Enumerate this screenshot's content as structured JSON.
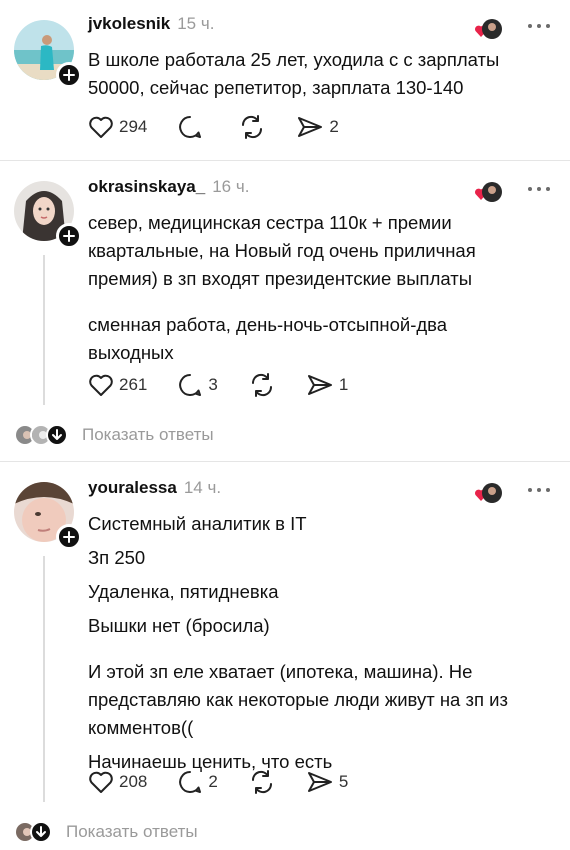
{
  "colors": {
    "text": "#111111",
    "muted": "#9a9a9a",
    "divider": "#e5e5e5",
    "heart_red": "#e8234a"
  },
  "posts": [
    {
      "username": "jvkolesnik",
      "time": "15 ч.",
      "lines": [
        "В школе работала 25 лет, уходила с с зарплаты",
        "50000, сейчас репетитор, зарплата 130-140"
      ],
      "likes": "294",
      "comments": "",
      "shares": "2"
    },
    {
      "username": "okrasinskaya_",
      "time": "16 ч.",
      "lines": [
        "север, медицинская сестра 110к + премии",
        "квартальные, на Новый год  очень приличная",
        "премия) в зп входят президентские выплаты",
        "сменная работа, день-ночь-отсыпной-два",
        "выходных"
      ],
      "likes": "261",
      "comments": "3",
      "shares": "1",
      "show_replies": "Показать ответы"
    },
    {
      "username": "youralessa",
      "time": "14 ч.",
      "lines": [
        "Системный аналитик в IT",
        "Зп 250",
        "Удаленка, пятидневка",
        "Вышки нет (бросила)",
        "И этой зп еле хватает (ипотека, машина). Не",
        "представляю как некоторые люди живут на зп из",
        "комментов((",
        "Начинаешь ценить, что есть"
      ],
      "likes": "208",
      "comments": "2",
      "shares": "5",
      "show_replies": "Показать ответы"
    }
  ],
  "icons": {
    "like": "heart-outline-icon",
    "comment": "comment-bubble-icon",
    "repost": "repost-arrows-icon",
    "share": "send-icon",
    "more": "more-dots-icon",
    "follow": "plus-icon",
    "reaction": "heart-reaction-icon",
    "expand": "chevron-down-icon"
  }
}
